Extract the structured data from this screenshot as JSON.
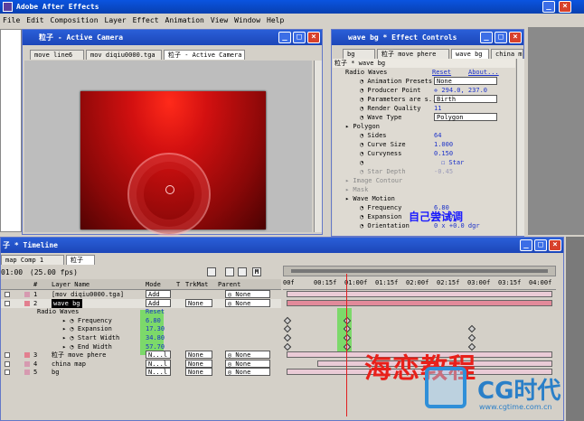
{
  "app": {
    "title": "Adobe After Effects",
    "menu": [
      "File",
      "Edit",
      "Composition",
      "Layer",
      "Effect",
      "Animation",
      "View",
      "Window",
      "Help"
    ]
  },
  "comp": {
    "title": "粒子 - Active Camera",
    "tabs": [
      "move line6",
      "mov diqiu0000.tga",
      "粒子 - Active Camera"
    ]
  },
  "effects": {
    "title": "wave bg * Effect Controls",
    "tabs": [
      "bg",
      "粒子 move phere",
      "wave bg",
      "china map"
    ],
    "crumb": "粒子 * wave bg",
    "effect_name": "Radio Waves",
    "reset": "Reset",
    "about": "About...",
    "props": [
      {
        "label": "Animation Presets",
        "value": "None",
        "type": "select"
      },
      {
        "label": "Producer Point",
        "value": "294.0, 237.0",
        "type": "point"
      },
      {
        "label": "Parameters are s...",
        "value": "Birth",
        "type": "select"
      },
      {
        "label": "Render Quality",
        "value": "11",
        "type": "num"
      },
      {
        "label": "Wave Type",
        "value": "Polygon",
        "type": "select"
      },
      {
        "label": "Polygon",
        "value": "",
        "type": "group"
      },
      {
        "label": "Sides",
        "value": "64",
        "type": "num"
      },
      {
        "label": "Curve Size",
        "value": "1.000",
        "type": "num"
      },
      {
        "label": "Curvyness",
        "value": "0.150",
        "type": "num"
      },
      {
        "label": "",
        "value": "Star",
        "type": "check"
      },
      {
        "label": "Star Depth",
        "value": "-0.45",
        "type": "dim"
      },
      {
        "label": "Image Contour",
        "value": "",
        "type": "dimgroup"
      },
      {
        "label": "Mask",
        "value": "",
        "type": "dimgroup"
      },
      {
        "label": "Wave Motion",
        "value": "",
        "type": "group"
      },
      {
        "label": "Frequency",
        "value": "6.80",
        "type": "hl"
      },
      {
        "label": "Expansion",
        "value": "17.30",
        "type": "hl"
      },
      {
        "label": "Orientation",
        "value": "0 x +0.0 dgr",
        "type": "hl"
      }
    ],
    "note": "自己尝试调"
  },
  "timeline": {
    "title": "子 * Timeline",
    "tabs": [
      "map Comp 1",
      "粒子"
    ],
    "time": "01:00",
    "fps": "(25.00 fps)",
    "headers": {
      "num": "#",
      "layer": "Layer Name",
      "mode": "Mode",
      "t": "T",
      "trk": "TrkMat",
      "parent": "Parent"
    },
    "ruler": [
      "00f",
      "00:15f",
      "01:00f",
      "01:15f",
      "02:00f",
      "02:15f",
      "03:00f",
      "03:15f",
      "04:00f"
    ],
    "layers": [
      {
        "num": "1",
        "name": "[mov diqiu0000.tga]",
        "mode": "Add",
        "trk": "",
        "parent": "None"
      },
      {
        "num": "2",
        "name": "wave bg",
        "mode": "Add",
        "trk": "None",
        "parent": "None"
      },
      {
        "num": "",
        "name": "Radio Waves",
        "mode": "Reset",
        "trk": "",
        "parent": ""
      },
      {
        "num": "",
        "name": "Frequency",
        "mode": "6.80",
        "trk": "",
        "parent": ""
      },
      {
        "num": "",
        "name": "Expansion",
        "mode": "17.30",
        "trk": "",
        "parent": ""
      },
      {
        "num": "",
        "name": "Start Width",
        "mode": "34.80",
        "trk": "",
        "parent": ""
      },
      {
        "num": "",
        "name": "End Width",
        "mode": "57.70",
        "trk": "",
        "parent": ""
      },
      {
        "num": "3",
        "name": "粒子 move phere",
        "mode": "N...l",
        "trk": "None",
        "parent": "None"
      },
      {
        "num": "4",
        "name": "china map",
        "mode": "N...l",
        "trk": "None",
        "parent": "None"
      },
      {
        "num": "5",
        "name": "bg",
        "mode": "N...l",
        "trk": "None",
        "parent": "None"
      }
    ],
    "watermark": "海恋教程"
  },
  "brand": {
    "name": "CG时代",
    "url": "www.cgtime.com.cn"
  }
}
